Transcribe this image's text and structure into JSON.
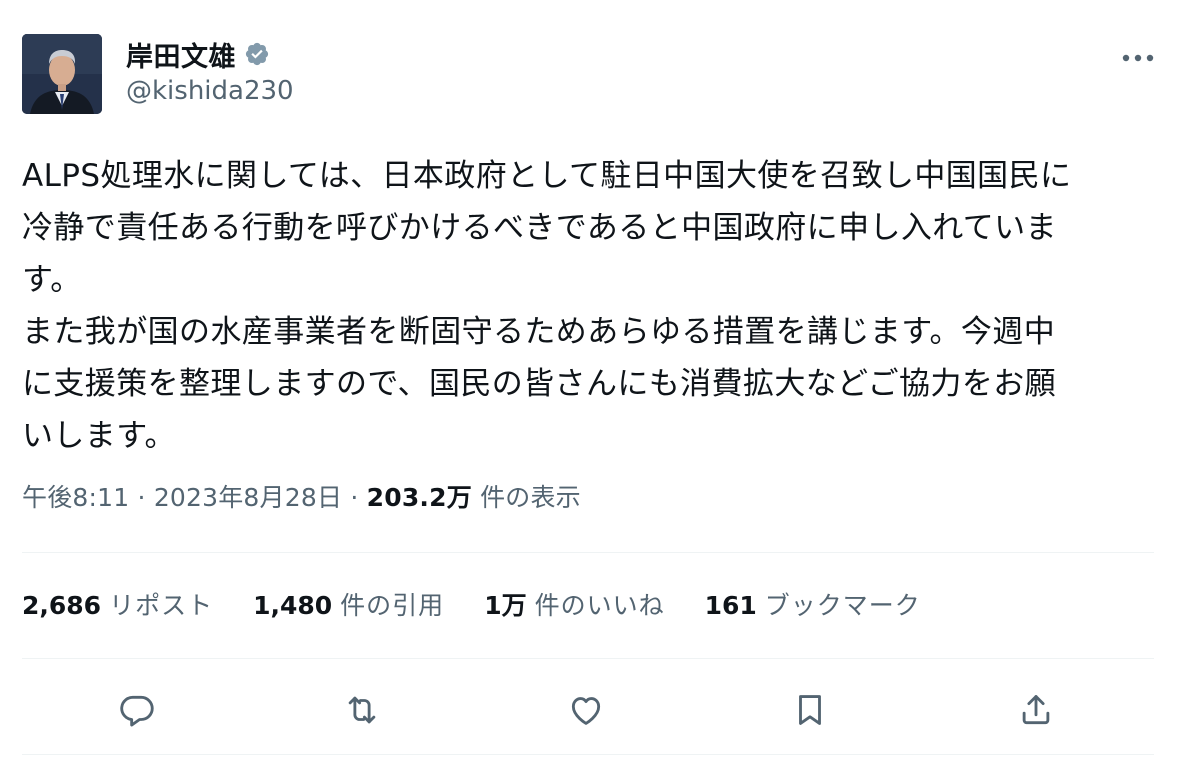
{
  "author": {
    "display_name": "岸田文雄",
    "handle": "@kishida230",
    "verified_color": "#829aab"
  },
  "tweet": {
    "paragraph1": "ALPS処理水に関しては、日本政府として駐日中国大使を召致し中国国民に\n冷静で責任ある行動を呼びかけるべきであると中国政府に申し入れていま\nす。",
    "paragraph2": "また我が国の水産事業者を断固守るためあらゆる措置を講じます。今週中\nに支援策を整理しますので、国民の皆さんにも消費拡大などご協力をお願\nいします。"
  },
  "meta": {
    "time": "午後8:11",
    "separator": "·",
    "date": "2023年8月28日",
    "views_count": "203.2万",
    "views_label": "件の表示"
  },
  "stats": [
    {
      "num": "2,686",
      "label": "リポスト"
    },
    {
      "num": "1,480",
      "label": "件の引用"
    },
    {
      "num": "1万",
      "label": "件のいいね"
    },
    {
      "num": "161",
      "label": "ブックマーク"
    }
  ],
  "actions": [
    "reply-icon",
    "repost-icon",
    "like-icon",
    "bookmark-icon",
    "share-icon"
  ],
  "colors": {
    "text_primary": "#0f1419",
    "text_secondary": "#536471",
    "divider": "#eff3f4"
  }
}
